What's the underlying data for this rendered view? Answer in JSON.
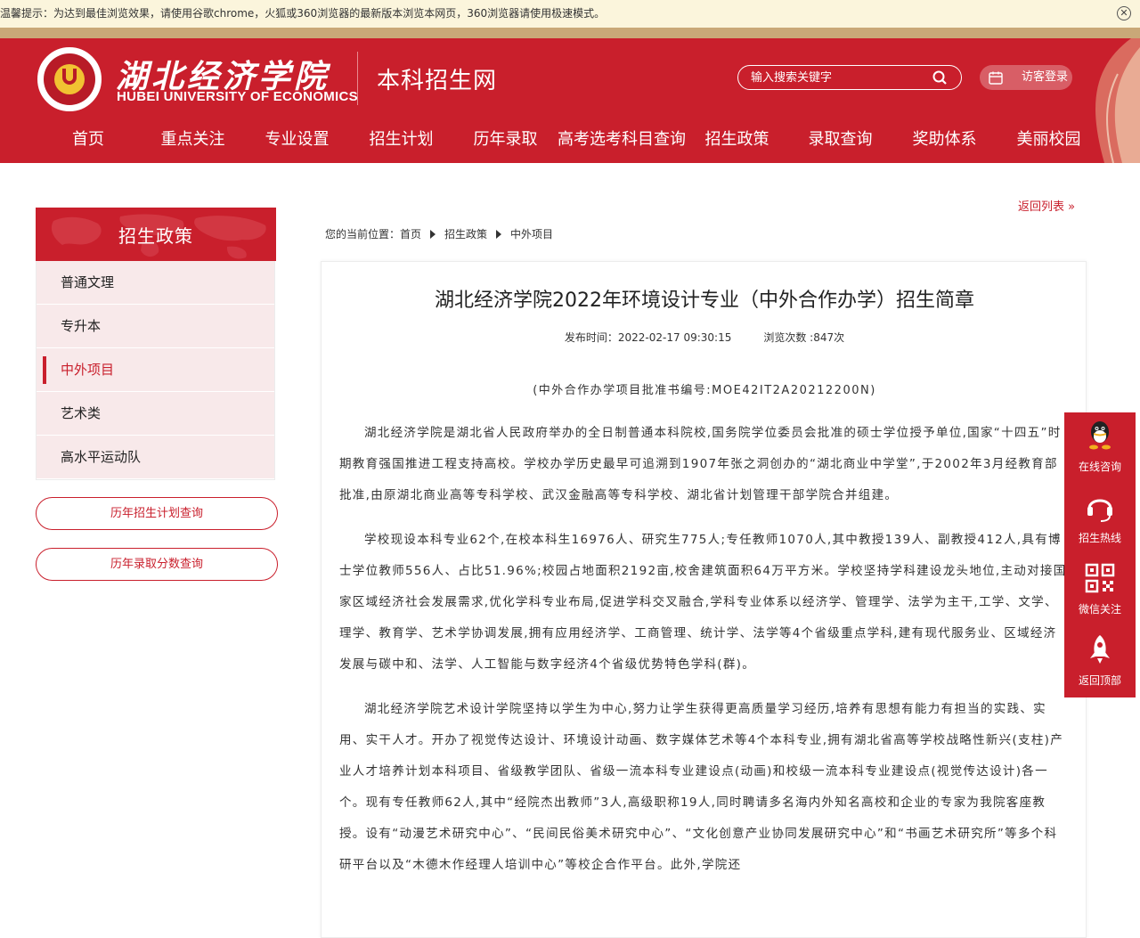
{
  "notice": {
    "text": "温馨提示：为达到最佳浏览效果，请使用谷歌chrome，火狐或360浏览器的最新版本浏览本网页，360浏览器请使用极速模式。",
    "close_icon": "close-icon"
  },
  "header": {
    "logo_cn": "湖北经济学院",
    "logo_en": "HUBEI UNIVERSITY OF ECONOMICS",
    "site_name": "本科招生网",
    "search_placeholder": "输入搜索关键字",
    "login_label": "访客登录",
    "brand_color": "#c91f2c"
  },
  "nav": [
    "首页",
    "重点关注",
    "专业设置",
    "招生计划",
    "历年录取",
    "高考选考科目查询",
    "招生政策",
    "录取查询",
    "奖助体系",
    "美丽校园"
  ],
  "back_link": "返回列表 »",
  "sidebar": {
    "title": "招生政策",
    "items": [
      {
        "label": "普通文理"
      },
      {
        "label": "专升本"
      },
      {
        "label": "中外项目"
      },
      {
        "label": "艺术类"
      },
      {
        "label": "高水平运动队"
      }
    ],
    "active_index": 2,
    "buttons": [
      "历年招生计划查询",
      "历年录取分数查询"
    ]
  },
  "breadcrumb": {
    "prefix": "您的当前位置：",
    "items": [
      "首页",
      "招生政策",
      "中外项目"
    ]
  },
  "article": {
    "title": "湖北经济学院2022年环境设计专业（中外合作办学）招生简章",
    "publish": "发布时间：2022-02-17 09:30:15",
    "views": "浏览次数 :847次",
    "approval": "(中外合作办学项目批准书编号:MOE42IT2A20212200N)",
    "paragraphs": [
      "湖北经济学院是湖北省人民政府举办的全日制普通本科院校,国务院学位委员会批准的硕士学位授予单位,国家“十四五”时期教育强国推进工程支持高校。学校办学历史最早可追溯到1907年张之洞创办的“湖北商业中学堂”,于2002年3月经教育部批准,由原湖北商业高等专科学校、武汉金融高等专科学校、湖北省计划管理干部学院合并组建。",
      "学校现设本科专业62个,在校本科生16976人、研究生775人;专任教师1070人,其中教授139人、副教授412人,具有博士学位教师556人、占比51.96%;校园占地面积2192亩,校舍建筑面积64万平方米。学校坚持学科建设龙头地位,主动对接国家区域经济社会发展需求,优化学科专业布局,促进学科交叉融合,学科专业体系以经济学、管理学、法学为主干,工学、文学、理学、教育学、艺术学协调发展,拥有应用经济学、工商管理、统计学、法学等4个省级重点学科,建有现代服务业、区域经济发展与碳中和、法学、人工智能与数字经济4个省级优势特色学科(群)。",
      "湖北经济学院艺术设计学院坚持以学生为中心,努力让学生获得更高质量学习经历,培养有思想有能力有担当的实践、实用、实干人才。开办了视觉传达设计、环境设计动画、数字媒体艺术等4个本科专业,拥有湖北省高等学校战略性新兴(支柱)产业人才培养计划本科项目、省级教学团队、省级一流本科专业建设点(动画)和校级一流本科专业建设点(视觉传达设计)各一个。现有专任教师62人,其中“经院杰出教师”3人,高级职称19人,同时聘请多名海内外知名高校和企业的专家为我院客座教授。设有“动漫艺术研究中心”、“民间民俗美术研究中心”、“文化创意产业协同发展研究中心”和“书画艺术研究所”等多个科研平台以及“木德木作经理人培训中心”等校企合作平台。此外,学院还"
    ]
  },
  "float_menu": [
    {
      "label": "在线咨询",
      "icon": "qq-icon"
    },
    {
      "label": "招生热线",
      "icon": "headset-icon"
    },
    {
      "label": "微信关注",
      "icon": "qr-code-icon"
    },
    {
      "label": "返回顶部",
      "icon": "rocket-icon"
    }
  ]
}
